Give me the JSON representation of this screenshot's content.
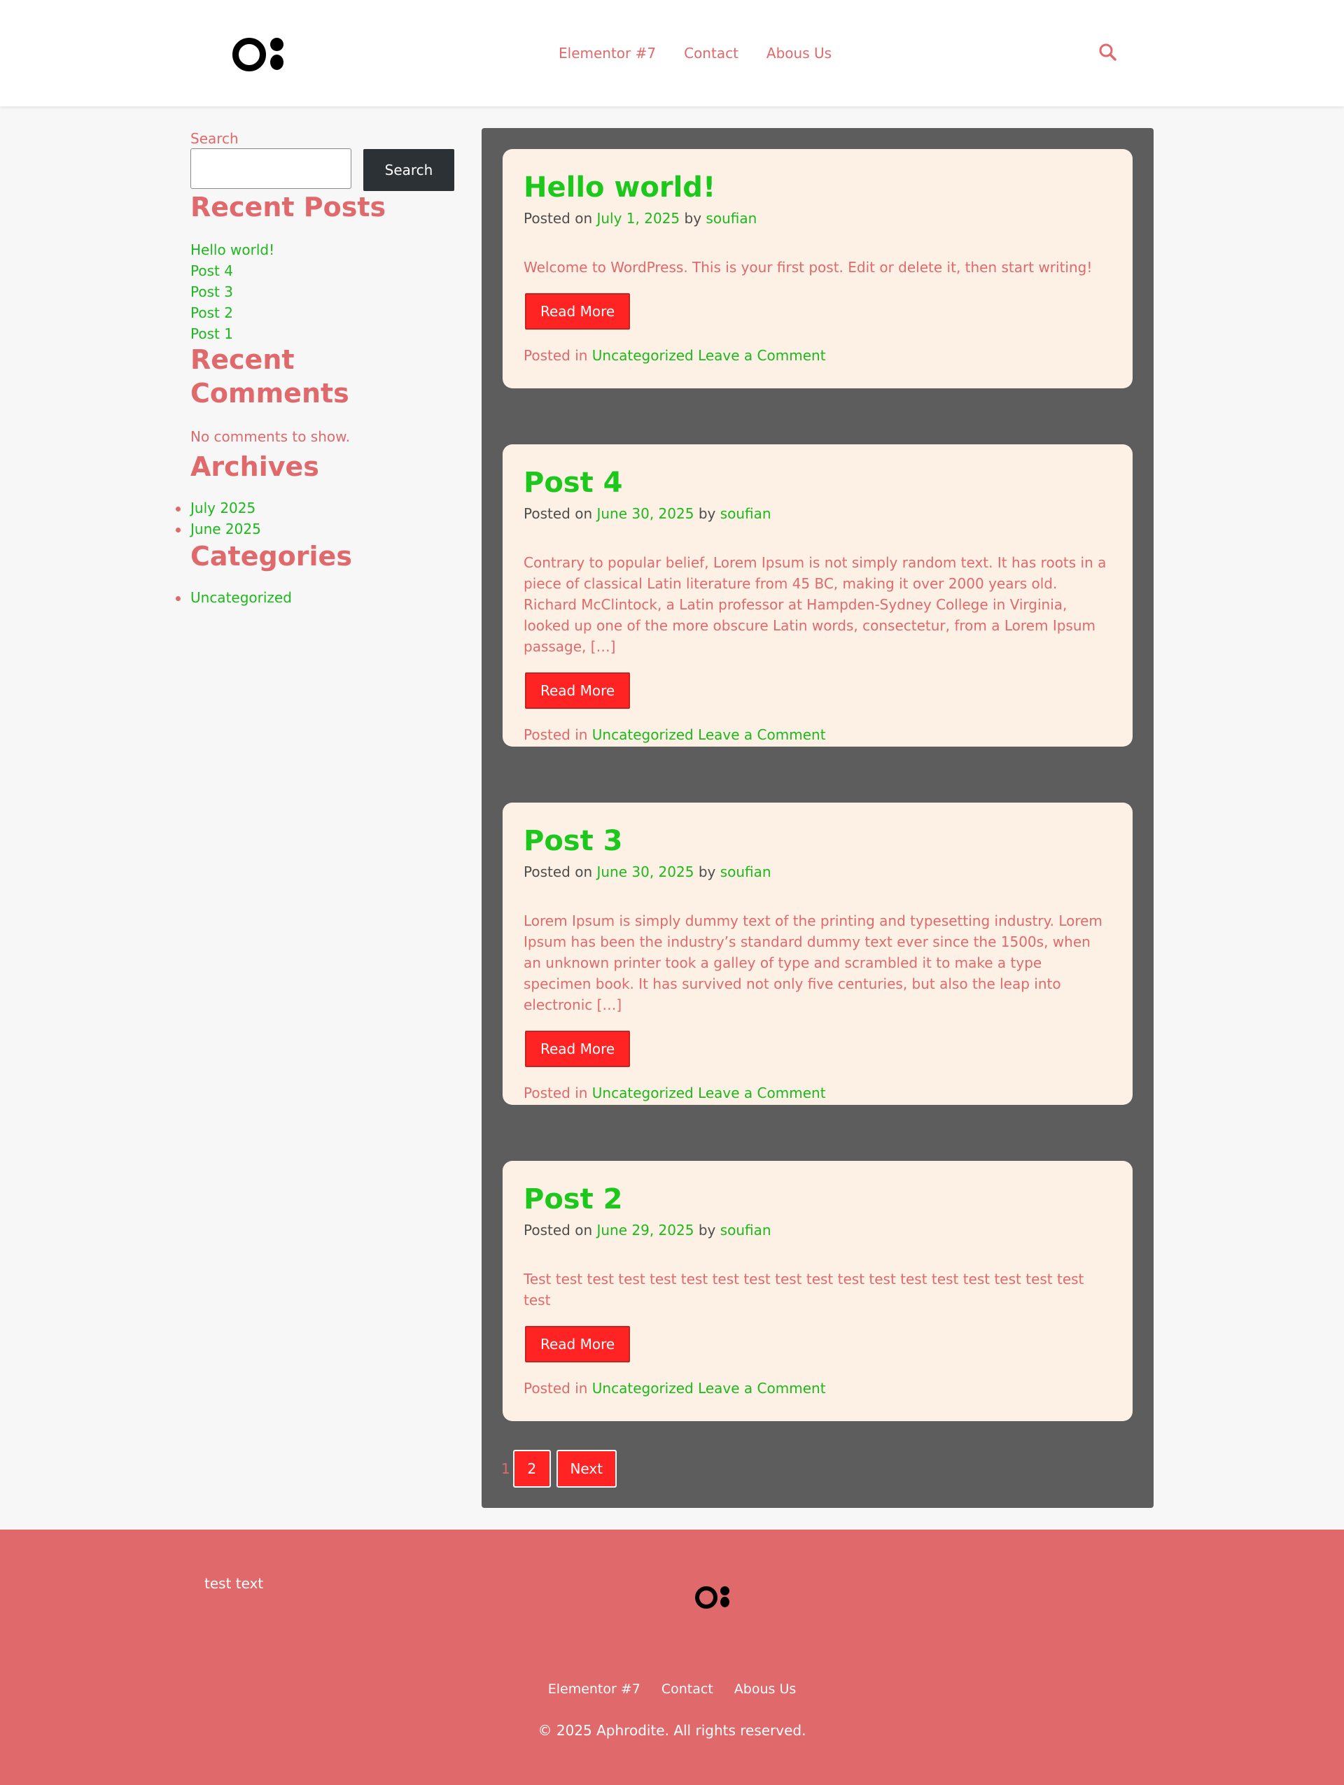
{
  "header": {
    "nav": [
      "Elementor #7",
      "Contact",
      "Abous Us"
    ]
  },
  "sidebar": {
    "search_label": "Search",
    "search_placeholder": "",
    "search_button": "Search",
    "recent_posts_heading": "Recent Posts",
    "recent_posts": [
      "Hello world!",
      "Post 4",
      "Post 3",
      "Post 2",
      "Post 1"
    ],
    "recent_comments_heading": "Recent Comments",
    "no_comments": "No comments to show.",
    "archives_heading": "Archives",
    "archives": [
      "July 2025",
      "June 2025"
    ],
    "categories_heading": "Categories",
    "categories": [
      "Uncategorized"
    ]
  },
  "posts": [
    {
      "title": "Hello world!",
      "posted_on": "Posted on",
      "date": "July 1, 2025",
      "by": "by",
      "author": "soufian",
      "excerpt": "Welcome to WordPress. This is your first post. Edit or delete it, then start writing!",
      "read_more": "Read More",
      "posted_in": "Posted in",
      "category": "Uncategorized",
      "comment_link": "Leave a Comment"
    },
    {
      "title": "Post 4",
      "posted_on": "Posted on",
      "date": "June 30, 2025",
      "by": "by",
      "author": "soufian",
      "excerpt": "Contrary to popular belief, Lorem Ipsum is not simply random text. It has roots in a piece of classical Latin literature from 45 BC, making it over 2000 years old. Richard McClintock, a Latin professor at Hampden-Sydney College in Virginia, looked up one of the more obscure Latin words, consectetur, from a Lorem Ipsum passage, […]",
      "read_more": "Read More",
      "posted_in": "Posted in",
      "category": "Uncategorized",
      "comment_link": "Leave a Comment"
    },
    {
      "title": "Post 3",
      "posted_on": "Posted on",
      "date": "June 30, 2025",
      "by": "by",
      "author": "soufian",
      "excerpt": "Lorem Ipsum is simply dummy text of the printing and typesetting industry. Lorem Ipsum has been the industry’s standard dummy text ever since the 1500s, when an unknown printer took a galley of type and scrambled it to make a type specimen book. It has survived not only five centuries, but also the leap into electronic […]",
      "read_more": "Read More",
      "posted_in": "Posted in",
      "category": "Uncategorized",
      "comment_link": "Leave a Comment"
    },
    {
      "title": "Post 2",
      "posted_on": "Posted on",
      "date": "June 29, 2025",
      "by": "by",
      "author": "soufian",
      "excerpt": "Test test test test test test test test test test test test test test test test test test test",
      "read_more": "Read More",
      "posted_in": "Posted in",
      "category": "Uncategorized",
      "comment_link": "Leave a Comment"
    }
  ],
  "pagination": {
    "current": "1",
    "page2": "2",
    "next": "Next"
  },
  "footer": {
    "text": "test text",
    "nav": [
      "Elementor #7",
      "Contact",
      "Abous Us"
    ],
    "copyright": "© 2025 Aphrodite. All rights reserved."
  },
  "colors": {
    "accent": "#e0696b",
    "link_green": "#1cb81c",
    "title_green": "#1cc81c",
    "button_red": "#ff2323",
    "main_bg": "#5d5d5d",
    "card_bg": "#fdf1e5"
  },
  "icons": {
    "header_search": "search-icon"
  }
}
